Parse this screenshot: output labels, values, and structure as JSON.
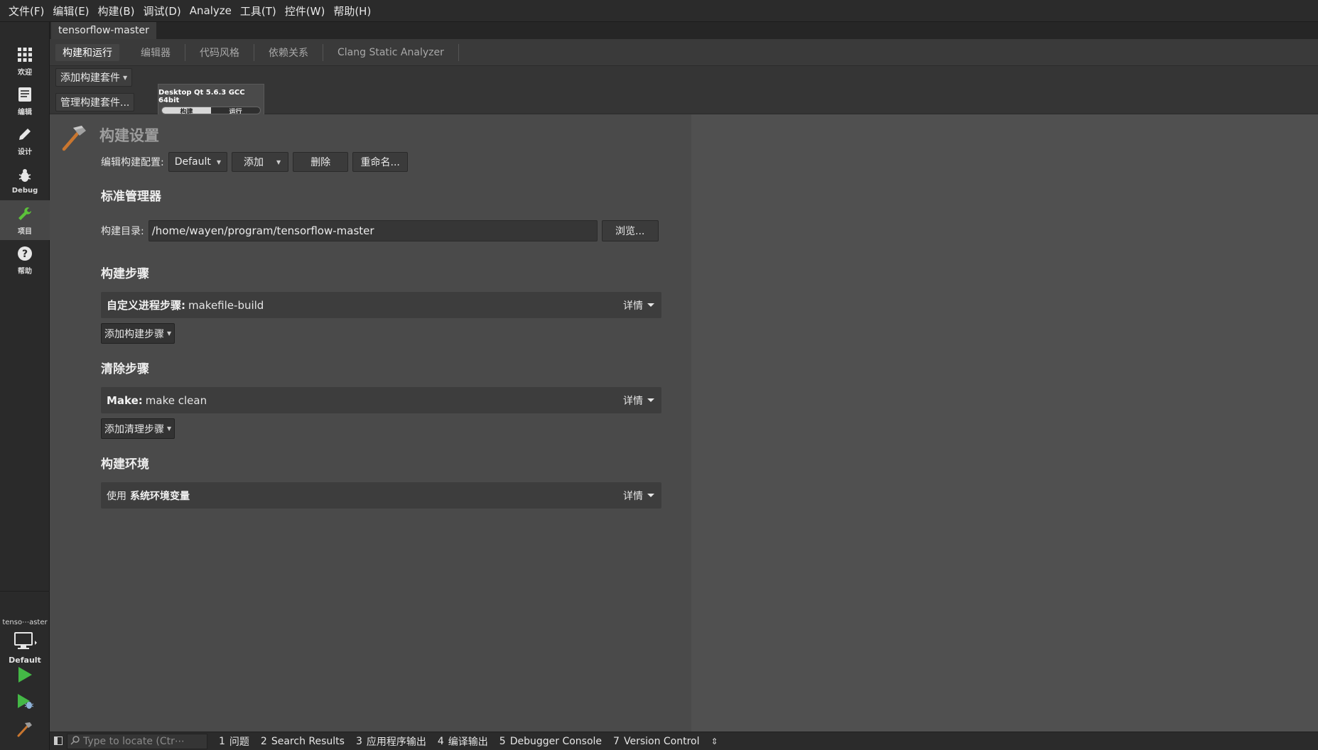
{
  "menu": [
    "文件(F)",
    "编辑(E)",
    "构建(B)",
    "调试(D)",
    "Analyze",
    "工具(T)",
    "控件(W)",
    "帮助(H)"
  ],
  "modes": [
    {
      "label": "欢迎",
      "icon": "grid-icon"
    },
    {
      "label": "编辑",
      "icon": "document-icon"
    },
    {
      "label": "设计",
      "icon": "pencil-icon"
    },
    {
      "label": "Debug",
      "icon": "bug-icon"
    },
    {
      "label": "项目",
      "icon": "wrench-icon",
      "active": true
    },
    {
      "label": "帮助",
      "icon": "help-icon"
    }
  ],
  "kit_selector": {
    "project_name": "tenso⋯aster",
    "build_config": "Default"
  },
  "project_tab": "tensorflow-master",
  "settings_tabs": [
    "构建和运行",
    "编辑器",
    "代码风格",
    "依赖关系",
    "Clang Static Analyzer"
  ],
  "kits": {
    "add_kit": "添加构建套件",
    "manage_kits": "管理构建套件...",
    "card_title": "Desktop Qt 5.6.3 GCC 64bit",
    "build_label": "构建",
    "run_label": "运行"
  },
  "build_settings": {
    "title": "构建设置",
    "config_label": "编辑构建配置:",
    "config_value": "Default",
    "add_button": "添加",
    "delete_button": "删除",
    "rename_button": "重命名...",
    "generic_manager_title": "标准管理器",
    "build_dir_label": "构建目录:",
    "build_dir_value": "/home/wayen/program/tensorflow-master",
    "browse_button": "浏览...",
    "build_steps_title": "构建步骤",
    "custom_step_label": "自定义进程步骤:",
    "custom_step_value": "makefile-build",
    "details_label": "详情",
    "add_build_step": "添加构建步骤",
    "clean_steps_title": "清除步骤",
    "make_label": "Make:",
    "make_value": "make clean",
    "add_clean_step": "添加清理步骤",
    "build_env_title": "构建环境",
    "env_use": "使用",
    "env_value": "系统环境变量"
  },
  "statusbar": {
    "locator_placeholder": "Type to locate (Ctr⋯",
    "panes": [
      {
        "num": "1",
        "label": "问题"
      },
      {
        "num": "2",
        "label": "Search Results"
      },
      {
        "num": "3",
        "label": "应用程序输出"
      },
      {
        "num": "4",
        "label": "编译输出"
      },
      {
        "num": "5",
        "label": "Debugger Console"
      },
      {
        "num": "7",
        "label": "Version Control"
      }
    ]
  },
  "colors": {
    "run_green": "#44b846",
    "hammer_orange": "#c9762f"
  }
}
